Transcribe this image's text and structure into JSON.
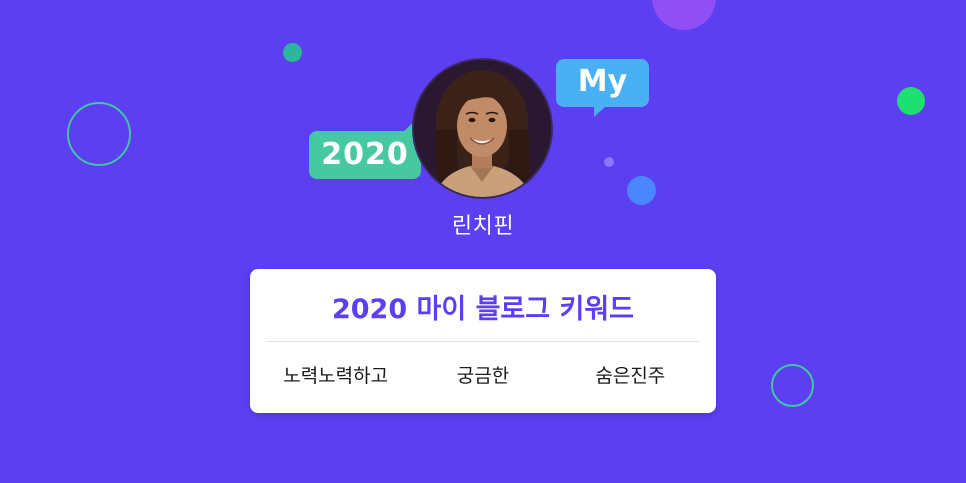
{
  "profile": {
    "username": "린치핀",
    "avatar_label": "profile-photo"
  },
  "badges": {
    "year": "2020",
    "my": "My"
  },
  "card": {
    "title": "2020 마이 블로그 키워드",
    "keywords": [
      "노력노력하고",
      "궁금한",
      "숨은진주"
    ]
  },
  "colors": {
    "background": "#5b3ff0",
    "accent": "#5b3ff0",
    "year_bubble": "#46c9a0",
    "my_bubble": "#49b0f3",
    "green_dot": "#1fe06e",
    "blue_dot": "#4a86ff"
  }
}
